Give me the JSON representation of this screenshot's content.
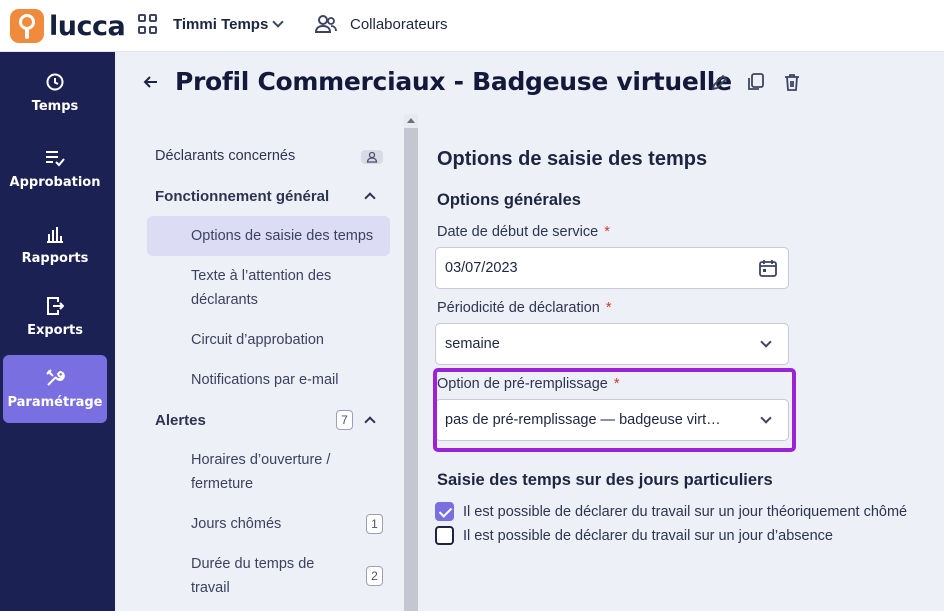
{
  "topbar": {
    "brand": "lucca",
    "app_name": "Timmi Temps",
    "collaborators": "Collaborateurs"
  },
  "leftnav": {
    "items": [
      {
        "label": "Temps",
        "icon": "clock-icon"
      },
      {
        "label": "Approbation",
        "icon": "list-check-icon"
      },
      {
        "label": "Rapports",
        "icon": "bar-chart-icon"
      },
      {
        "label": "Exports",
        "icon": "export-icon"
      },
      {
        "label": "Paramétrage",
        "icon": "tools-icon",
        "active": true
      }
    ]
  },
  "header": {
    "title": "Profil Commerciaux - Badgeuse virtuelle"
  },
  "submenu": {
    "declarants": "Déclarants concernés",
    "general_section": "Fonctionnement général",
    "general_items": [
      "Options de saisie des temps",
      "Texte à l’attention des déclarants",
      "Circuit d’approbation",
      "Notifications par e-mail"
    ],
    "general_item_lines": [
      [
        "Options de saisie des temps"
      ],
      [
        "Texte à l’attention des",
        "déclarants"
      ],
      [
        "Circuit d’approbation"
      ],
      [
        "Notifications par e-mail"
      ]
    ],
    "alerts_section": "Alertes",
    "alerts_count": "7",
    "alert_items": [
      {
        "lines": [
          "Horaires d’ouverture /",
          "fermeture"
        ],
        "count": ""
      },
      {
        "lines": [
          "Jours chômés"
        ],
        "count": "1"
      },
      {
        "lines": [
          "Durée du temps de",
          "travail"
        ],
        "count": "2"
      }
    ]
  },
  "content": {
    "section_title": "Options de saisie des temps",
    "general_title": "Options générales",
    "start_date_label": "Date de début de service",
    "start_date_value": "03/07/2023",
    "periodicity_label": "Périodicité de déclaration",
    "periodicity_value": "semaine",
    "prefill_label": "Option de pré-remplissage",
    "prefill_value": "pas de pré-remplissage — badgeuse virt…",
    "required_mark": "*",
    "special_days_title": "Saisie des temps sur des jours particuliers",
    "checkbox_1": "Il est possible de déclarer du travail sur un jour théoriquement chômé",
    "checkbox_1_checked": true,
    "checkbox_2": "Il est possible de déclarer du travail sur un jour d’absence",
    "checkbox_2_checked": false
  },
  "colors": {
    "nav_bg": "#1b2152",
    "nav_active": "#7a6fe0",
    "highlight": "#9b22d6",
    "brand_orange": "#f08a3c"
  }
}
